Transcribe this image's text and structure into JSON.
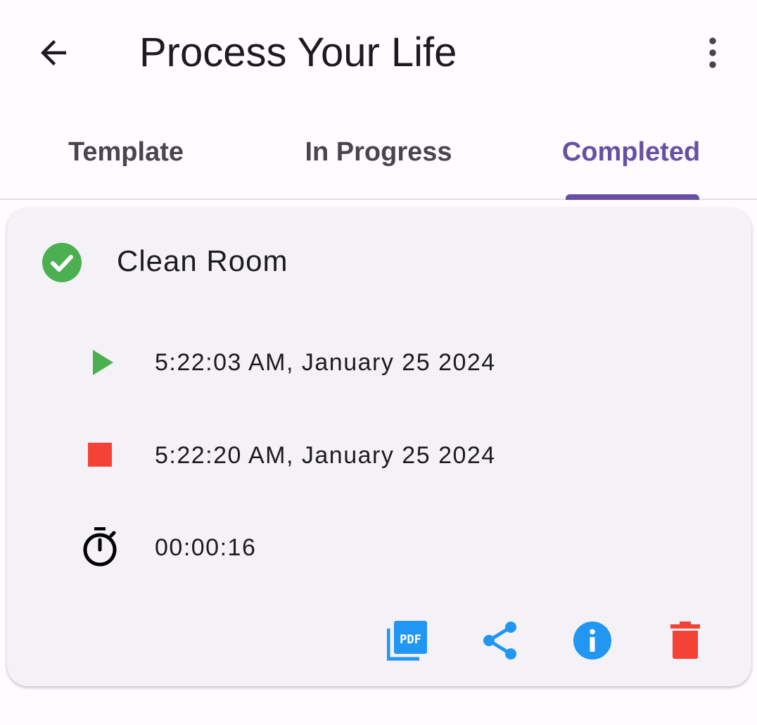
{
  "appbar": {
    "title": "Process Your Life",
    "back_icon": "arrow-back-icon",
    "more_icon": "more-vert-icon"
  },
  "tabs": [
    {
      "label": "Template",
      "active": false
    },
    {
      "label": "In Progress",
      "active": false
    },
    {
      "label": "Completed",
      "active": true
    }
  ],
  "card": {
    "status_icon": "check-circle-icon",
    "title": "Clean Room",
    "start": {
      "icon": "play-icon",
      "value": "5:22:03 AM, January 25 2024"
    },
    "stop": {
      "icon": "stop-icon",
      "value": "5:22:20 AM, January 25 2024"
    },
    "duration": {
      "icon": "timer-icon",
      "value": "00:00:16"
    },
    "actions": [
      "pdf-icon",
      "share-icon",
      "info-icon",
      "delete-icon"
    ]
  },
  "colors": {
    "accent": "#6750a4",
    "success": "#4caf50",
    "danger": "#f44336",
    "action_blue": "#2196f3",
    "card_bg": "#f4f1f7",
    "page_bg": "#fffbfe"
  }
}
